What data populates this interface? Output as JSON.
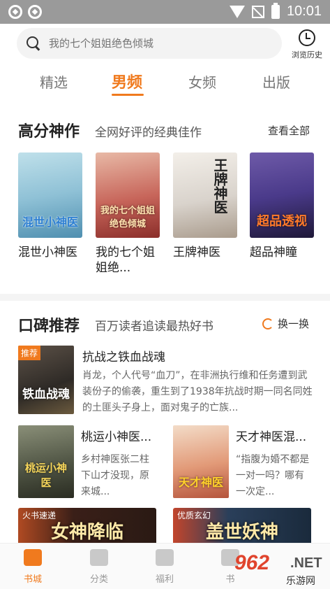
{
  "status_bar": {
    "time": "10:01"
  },
  "search": {
    "placeholder": "我的七个姐姐绝色倾城"
  },
  "history": {
    "label": "浏览历史"
  },
  "tabs": [
    {
      "label": "精选"
    },
    {
      "label": "男频",
      "active": true
    },
    {
      "label": "女频"
    },
    {
      "label": "出版"
    }
  ],
  "section_top": {
    "title": "高分神作",
    "subtitle": "全网好评的经典佳作",
    "action": "查看全部",
    "books": [
      {
        "name": "混世小神医",
        "cover_text": "混世小神医",
        "color": "#8fc1d6"
      },
      {
        "name": "我的七个姐姐绝...",
        "cover_text": "我的七个姐姐绝色倾城",
        "color": "#c7655a"
      },
      {
        "name": "王牌神医",
        "cover_text": "王牌神医",
        "color": "#d9d3cc"
      },
      {
        "name": "超品神瞳",
        "cover_text": "超品透视",
        "color": "#4a3a8a"
      }
    ]
  },
  "section_rec": {
    "title": "口碑推荐",
    "subtitle": "百万读者追读最热好书",
    "action": "换一换",
    "featured": {
      "tag": "推荐",
      "cover_text": "铁血战魂",
      "title": "抗战之铁血战魂",
      "desc": "肖龙，个人代号“血刀”，在非洲执行维和任务遭到武装份子的偷袭，重生到了1938年抗战时期一同名同姓的土匪头子身上，面对鬼子的亡族..."
    },
    "pairs": [
      {
        "title": "桃运小神医...",
        "cover_text": "桃运小神医",
        "desc": "乡村神医张二柱下山才没现，原来城..."
      },
      {
        "title": "天才神医混...",
        "cover_text": "天才神医",
        "desc": "“指腹为婚不都是一对一吗？哪有一次定..."
      }
    ],
    "banners": [
      {
        "tag": "火书速递",
        "text": "女神降临"
      },
      {
        "tag": "优质玄幻",
        "text": "盖世妖神"
      }
    ]
  },
  "bottom_nav": [
    {
      "label": "书城",
      "active": true
    },
    {
      "label": "分类"
    },
    {
      "label": "福利"
    },
    {
      "label": "书"
    }
  ],
  "watermark": {
    "num": "962",
    "net": ".NET",
    "sub": "乐游网"
  }
}
